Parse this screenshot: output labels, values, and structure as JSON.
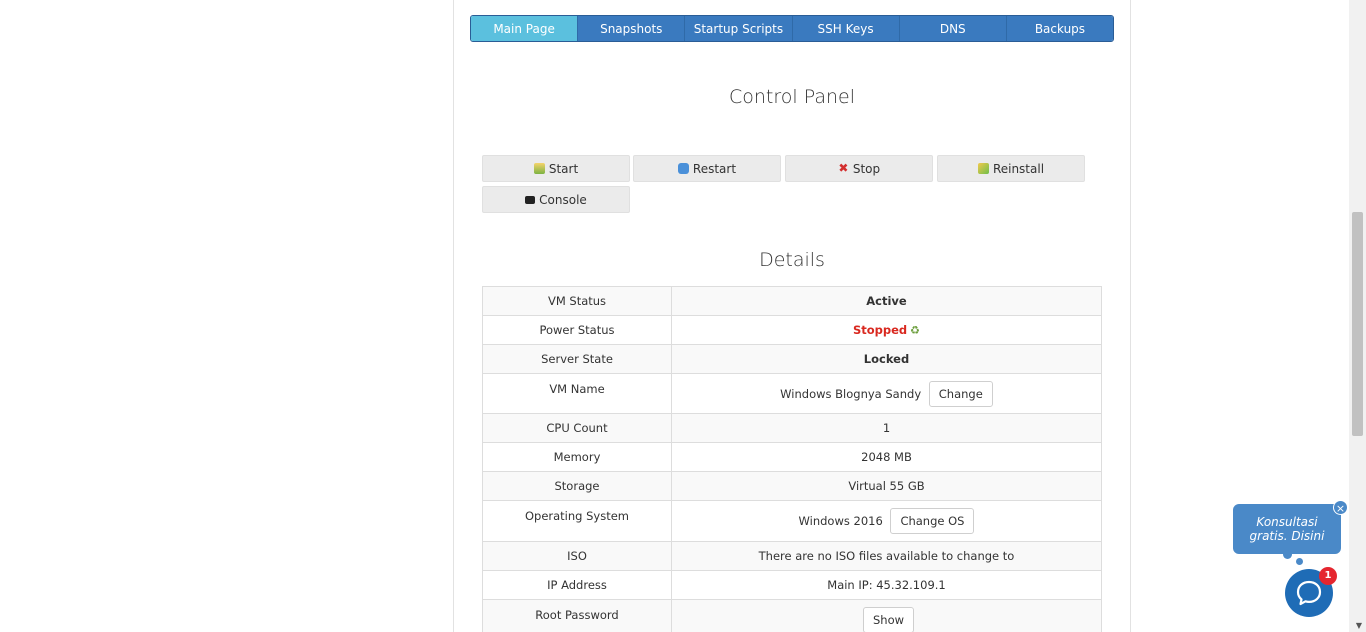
{
  "tabs": [
    {
      "label": "Main Page",
      "active": true
    },
    {
      "label": "Snapshots"
    },
    {
      "label": "Startup Scripts"
    },
    {
      "label": "SSH Keys"
    },
    {
      "label": "DNS"
    },
    {
      "label": "Backups"
    }
  ],
  "control_panel": {
    "title": "Control Panel",
    "buttons": {
      "start": "Start",
      "restart": "Restart",
      "stop": "Stop",
      "reinstall": "Reinstall",
      "console": "Console"
    }
  },
  "details": {
    "title": "Details",
    "rows": {
      "vm_status": {
        "label": "VM Status",
        "value": "Active"
      },
      "power_status": {
        "label": "Power Status",
        "value": "Stopped"
      },
      "server_state": {
        "label": "Server State",
        "value": "Locked"
      },
      "vm_name": {
        "label": "VM Name",
        "value": "Windows Blognya Sandy",
        "button": "Change"
      },
      "cpu_count": {
        "label": "CPU Count",
        "value": "1"
      },
      "memory": {
        "label": "Memory",
        "value": "2048 MB"
      },
      "storage": {
        "label": "Storage",
        "value": "Virtual 55 GB"
      },
      "os": {
        "label": "Operating System",
        "value": "Windows 2016",
        "button": "Change OS"
      },
      "iso": {
        "label": "ISO",
        "value": "There are no ISO files available to change to"
      },
      "ip": {
        "label": "IP Address",
        "value": "Main IP: 45.32.109.1"
      },
      "root_password": {
        "label": "Root Password",
        "button": "Show"
      }
    }
  },
  "chat": {
    "bubble_line1": "Konsultasi",
    "bubble_line2": "gratis. Disini",
    "close": "×",
    "badge": "1"
  },
  "colors": {
    "tab_bg": "#3a7abf",
    "tab_active": "#5bc0de",
    "stopped": "#d9281f",
    "chat": "#1f6cb6"
  }
}
